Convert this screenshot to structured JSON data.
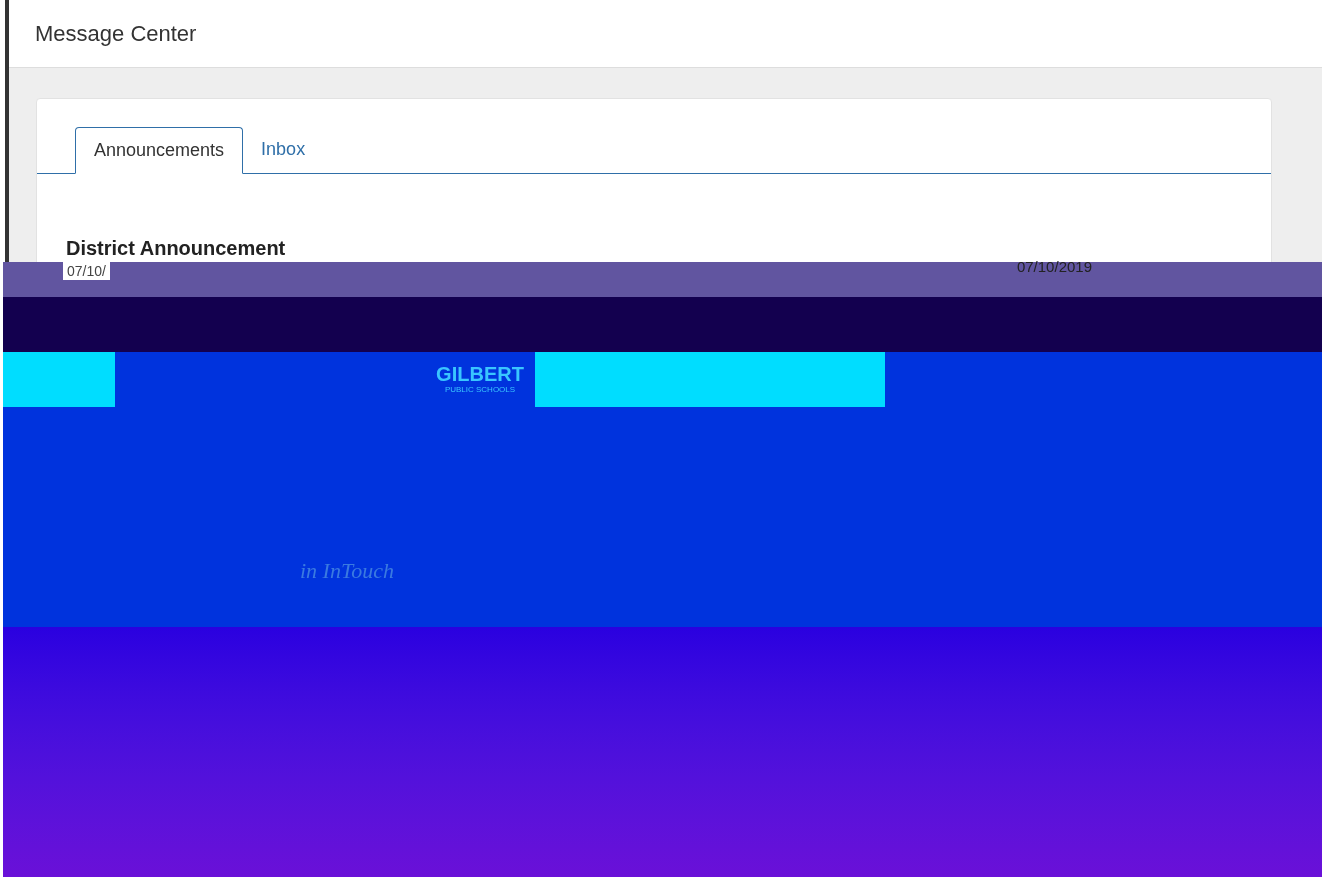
{
  "header": {
    "title": "Message Center"
  },
  "tabs": [
    {
      "label": "Announcements",
      "selected": true
    },
    {
      "label": "Inbox",
      "selected": false
    }
  ],
  "announcement": {
    "title": "District Announcement",
    "date": "07/10/",
    "second_date": "07/10/2019"
  },
  "banner": {
    "logo": "GILBERT",
    "logo_subtitle": "PUBLIC SCHOOLS",
    "tagline": "in InTouch"
  }
}
